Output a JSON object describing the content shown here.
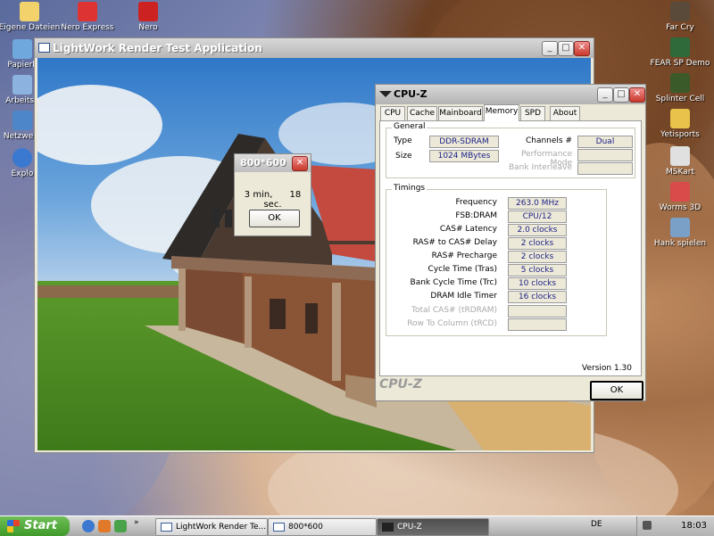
{
  "desktop": {
    "left_icons": [
      "Eigene Dateien",
      "Nero Express",
      "Nero",
      "Papierk",
      "Arbeitsp",
      "Netzwerk",
      "Explo"
    ],
    "right_icons": [
      "Far Cry",
      "FEAR SP Demo",
      "Splinter Cell",
      "Yetisports",
      "MSKart",
      "Worms 3D",
      "Hank spielen"
    ]
  },
  "lightwork": {
    "title": "LightWork Render Test Application"
  },
  "dialog": {
    "title": "800*600",
    "message_min": "3 min,",
    "message_sec": "18 sec.",
    "ok_label": "OK"
  },
  "cpuz": {
    "title": "CPU-Z",
    "tabs": [
      "CPU",
      "Cache",
      "Mainboard",
      "Memory",
      "SPD",
      "About"
    ],
    "active_tab": "Memory",
    "general": {
      "label": "General",
      "type_label": "Type",
      "type_value": "DDR-SDRAM",
      "size_label": "Size",
      "size_value": "1024 MBytes",
      "channels_label": "Channels #",
      "channels_value": "Dual",
      "perf_mode_label": "Performance Mode",
      "bank_interleave_label": "Bank Interleave"
    },
    "timings": {
      "label": "Timings",
      "rows": [
        {
          "label": "Frequency",
          "value": "263.0 MHz"
        },
        {
          "label": "FSB:DRAM",
          "value": "CPU/12"
        },
        {
          "label": "CAS# Latency",
          "value": "2.0 clocks"
        },
        {
          "label": "RAS# to CAS# Delay",
          "value": "2 clocks"
        },
        {
          "label": "RAS# Precharge",
          "value": "2 clocks"
        },
        {
          "label": "Cycle Time (Tras)",
          "value": "5 clocks"
        },
        {
          "label": "Bank Cycle Time (Trc)",
          "value": "10 clocks"
        },
        {
          "label": "DRAM Idle Timer",
          "value": "16 clocks"
        }
      ],
      "dim_rows": [
        "Total CAS# (tRDRAM)",
        "Row To Column (tRCD)"
      ]
    },
    "version": "Version 1.30",
    "brand": "CPU-Z",
    "ok_label": "OK"
  },
  "taskbar": {
    "start_label": "Start",
    "tasks": [
      "LightWork Render Te...",
      "800*600",
      "CPU-Z"
    ],
    "active_task": "CPU-Z",
    "language": "DE",
    "time": "18:03"
  },
  "colors": {
    "value_text": "#1b1f86",
    "start_green": "#3f9a2a",
    "close_red": "#c8382b"
  }
}
